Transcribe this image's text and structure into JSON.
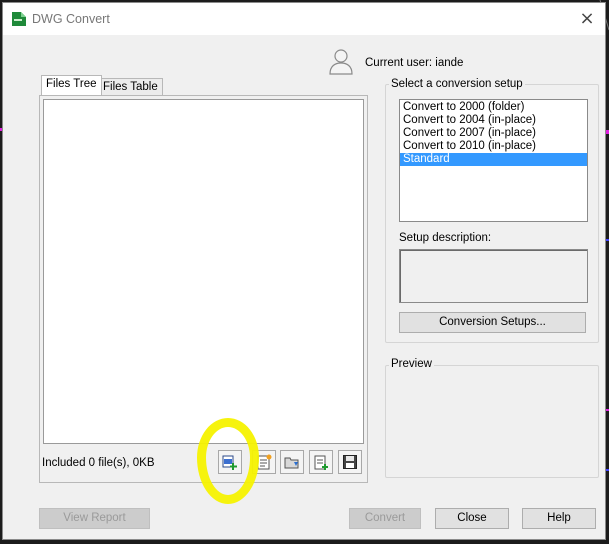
{
  "window": {
    "title": "DWG Convert",
    "close_glyph": "×"
  },
  "user": {
    "label": "Current user: iande",
    "icon": "user-silhouette-icon"
  },
  "tabs": [
    {
      "label": "Files Tree",
      "active": true
    },
    {
      "label": "Files Table",
      "active": false
    }
  ],
  "files": {
    "included_text": "Included 0 file(s), 0KB",
    "toolbar_icons": [
      "add-files-icon",
      "new-list-icon",
      "open-list-icon",
      "append-list-icon",
      "save-list-icon"
    ]
  },
  "conversion": {
    "caption": "Select a conversion setup",
    "setups": [
      {
        "label": "Convert to 2000 (folder)",
        "selected": false
      },
      {
        "label": "Convert to 2004 (in-place)",
        "selected": false
      },
      {
        "label": "Convert to 2007 (in-place)",
        "selected": false
      },
      {
        "label": "Convert to 2010 (in-place)",
        "selected": false
      },
      {
        "label": "Standard",
        "selected": true
      }
    ],
    "description_label": "Setup description:",
    "setups_button": "Conversion Setups..."
  },
  "preview": {
    "caption": "Preview"
  },
  "buttons": {
    "view_report": "View Report",
    "convert": "Convert",
    "close": "Close",
    "help": "Help"
  },
  "colors": {
    "selection": "#3399ff",
    "highlight": "#f5f200"
  }
}
